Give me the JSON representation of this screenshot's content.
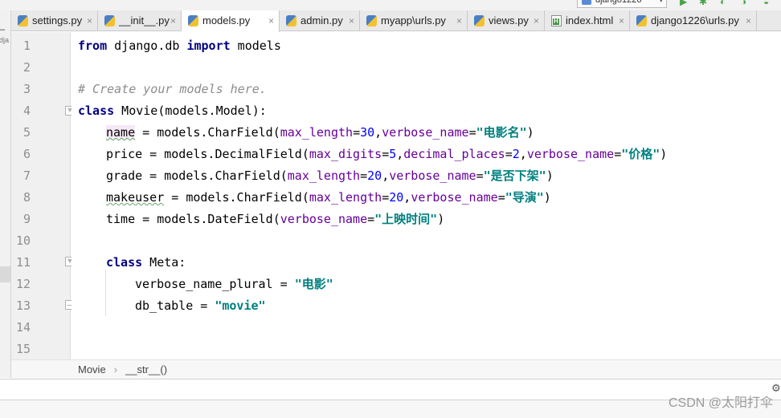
{
  "toolbar": {
    "run_config": "django1226",
    "run_icon": "play-icon",
    "debug_icon": "bug-icon"
  },
  "tabs": [
    {
      "label": "settings.py",
      "icon": "python-file-icon",
      "active": false
    },
    {
      "label": "__init__.py",
      "icon": "python-file-icon",
      "active": false
    },
    {
      "label": "models.py",
      "icon": "python-file-icon",
      "active": true
    },
    {
      "label": "admin.py",
      "icon": "python-file-icon",
      "active": false
    },
    {
      "label": "myapp\\urls.py",
      "icon": "python-file-icon",
      "active": false
    },
    {
      "label": "views.py",
      "icon": "python-file-icon",
      "active": false
    },
    {
      "label": "index.html",
      "icon": "html-file-icon",
      "active": false
    },
    {
      "label": "django1226\\urls.py",
      "icon": "python-file-icon",
      "active": false
    }
  ],
  "project_strip": {
    "label": "dja"
  },
  "line_numbers": [
    "1",
    "2",
    "3",
    "4",
    "5",
    "6",
    "7",
    "8",
    "9",
    "10",
    "11",
    "12",
    "13",
    "14",
    "15"
  ],
  "code": {
    "l1": {
      "kw1": "from",
      "t1": " django.db ",
      "kw2": "import",
      "t2": " models"
    },
    "l3": {
      "comment": "# Create your models here."
    },
    "l4": {
      "kw": "class",
      "t": " Movie(models.Model):"
    },
    "l5": {
      "field": "name",
      "t1": " = models.CharField(",
      "p1": "max_length",
      "eq1": "=",
      "n1": "30",
      "c1": ",",
      "p2": "verbose_name",
      "eq2": "=",
      "s": "\"电影名\"",
      "end": ")"
    },
    "l6": {
      "field": "price",
      "t1": " = models.DecimalField(",
      "p1": "max_digits",
      "eq1": "=",
      "n1": "5",
      "c1": ",",
      "p2": "decimal_places",
      "eq2": "=",
      "n2": "2",
      "c2": ",",
      "p3": "verbose_name",
      "eq3": "=",
      "s": "\"价格\"",
      "end": ")"
    },
    "l7": {
      "field": "grade",
      "t1": " = models.CharField(",
      "p1": "max_length",
      "eq1": "=",
      "n1": "20",
      "c1": ",",
      "p2": "verbose_name",
      "eq2": "=",
      "s": "\"是否下架\"",
      "end": ")"
    },
    "l8": {
      "field": "makeuser",
      "t1": " = models.CharField(",
      "p1": "max_length",
      "eq1": "=",
      "n1": "20",
      "c1": ",",
      "p2": "verbose_name",
      "eq2": "=",
      "s": "\"导演\"",
      "end": ")"
    },
    "l9": {
      "field": "time",
      "t1": " = models.DateField(",
      "p1": "verbose_name",
      "eq1": "=",
      "s": "\"上映时间\"",
      "end": ")"
    },
    "l11": {
      "kw": "class",
      "t": " Meta:"
    },
    "l12": {
      "t": "verbose_name_plural = ",
      "s": "\"电影\""
    },
    "l13": {
      "t": "db_table = ",
      "s": "\"movie\""
    }
  },
  "breadcrumb": {
    "item1": "Movie",
    "separator": "›",
    "item2": "__str__()"
  },
  "watermark": "CSDN @太阳打伞"
}
